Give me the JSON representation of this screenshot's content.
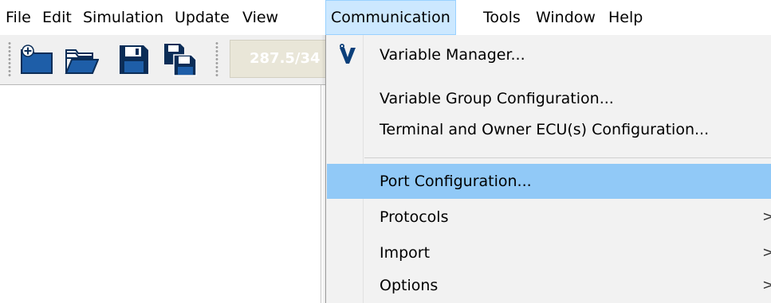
{
  "menubar": {
    "items": [
      "File",
      "Edit",
      "Simulation",
      "Update",
      "View",
      "Communication",
      "Tools",
      "Window",
      "Help"
    ],
    "active": "Communication"
  },
  "toolbar": {
    "buttons": [
      {
        "name": "new-file-icon"
      },
      {
        "name": "open-folder-icon"
      },
      {
        "name": "save-icon"
      },
      {
        "name": "save-all-icon"
      }
    ],
    "field_value": "287.5/34"
  },
  "communication_menu": {
    "items": [
      {
        "label": "Variable Manager...",
        "icon": "variable-manager-icon",
        "submenu": false
      },
      {
        "label": "Variable Group Configuration...",
        "submenu": false
      },
      {
        "label": "Terminal and Owner ECU(s) Configuration...",
        "submenu": false
      },
      {
        "label": "Port Configuration...",
        "submenu": false,
        "highlighted": true
      },
      {
        "label": "Protocols",
        "submenu": true
      },
      {
        "label": "Import",
        "submenu": true
      },
      {
        "label": "Options",
        "submenu": true
      }
    ],
    "submenu_arrow": ">"
  },
  "colors": {
    "menu_highlight": "#91c9f7",
    "menubar_active": "#cce8ff",
    "toolbar_bg": "#f0f0f0",
    "icon_blue": "#1e5ea8"
  }
}
